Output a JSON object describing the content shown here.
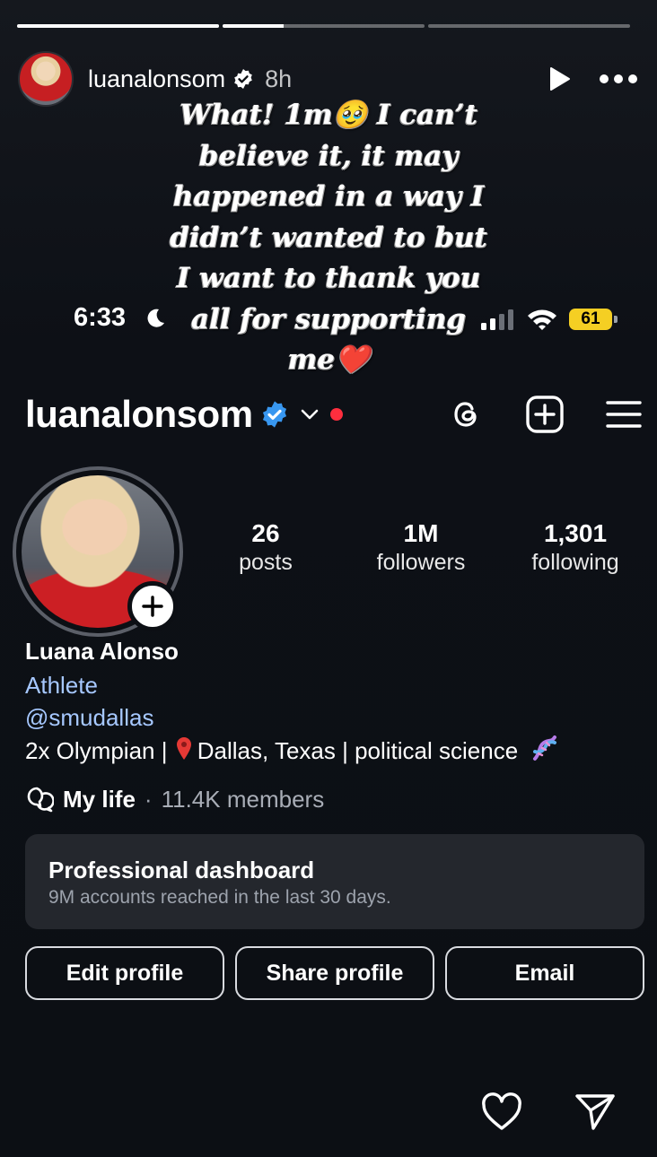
{
  "story": {
    "progress": [
      1.0,
      0.3,
      0.0
    ],
    "username": "luanalonsom",
    "time_ago": "8h",
    "caption": "What! 1m🥹 I can’t\nbelieve it, it may\nhappened in a way I\ndidn’t wanted to but\nI want to thank you\nall for supporting\nme❤️"
  },
  "statusbar": {
    "time": "6:33",
    "battery": "61"
  },
  "profile": {
    "username": "luanalonsom",
    "stats": [
      {
        "value": "26",
        "label": "posts"
      },
      {
        "value": "1M",
        "label": "followers"
      },
      {
        "value": "1,301",
        "label": "following"
      }
    ],
    "name": "Luana Alonso",
    "category": "Athlete",
    "link": "@smudallas",
    "bio_prefix": "2x Olympian |",
    "bio_location": "Dallas, Texas | political science",
    "channel": {
      "name": "My life",
      "separator": "·",
      "members": "11.4K members"
    },
    "dashboard": {
      "title": "Professional dashboard",
      "subtitle": "9M accounts reached in the last 30 days."
    },
    "buttons": {
      "edit": "Edit profile",
      "share": "Share profile",
      "email": "Email"
    }
  },
  "colors": {
    "accent_link": "#a6c8ff",
    "verified": "#3897f0",
    "notification_dot": "#ff2e3e",
    "battery": "#f5cf23"
  },
  "icons": [
    "play-icon",
    "more-icon",
    "moon-icon",
    "signal-icon",
    "wifi-icon",
    "threads-icon",
    "create-icon",
    "menu-icon",
    "add-story-icon",
    "channel-icon",
    "pin-icon",
    "dna-icon",
    "heart-icon",
    "send-icon"
  ]
}
